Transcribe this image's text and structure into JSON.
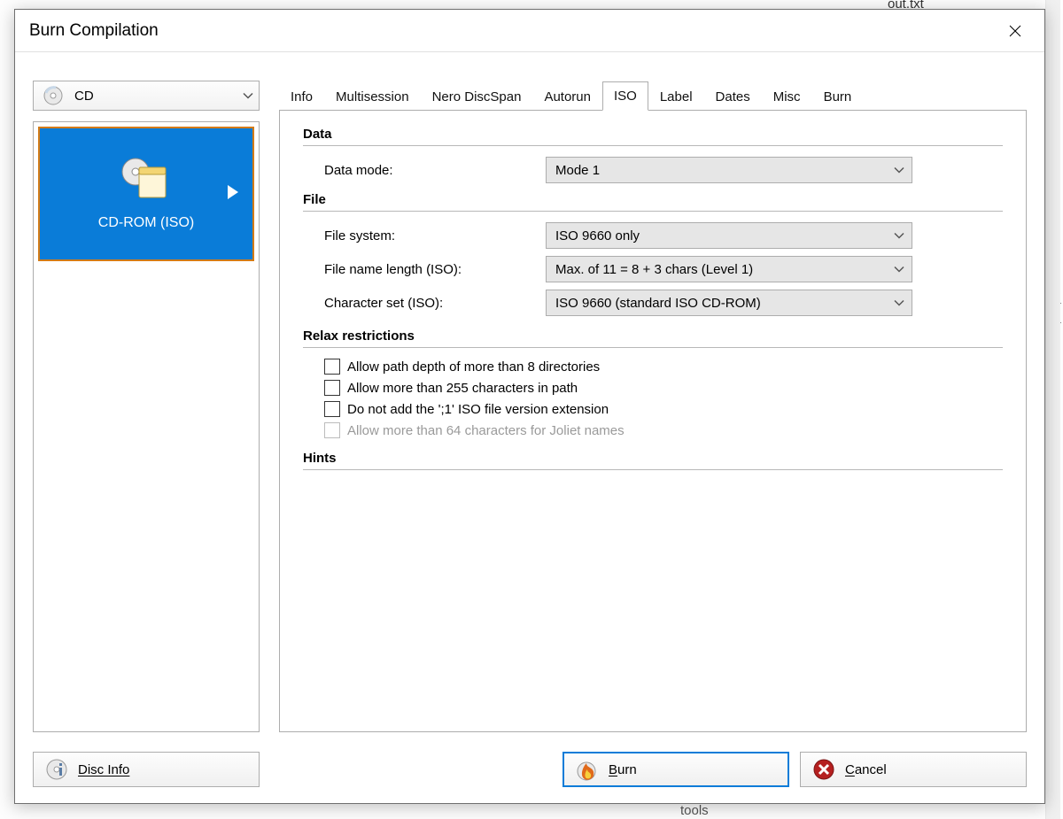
{
  "window": {
    "title": "Burn Compilation"
  },
  "background": {
    "file1": "out.txt",
    "trunc1": "t_",
    "trunc2": "t_",
    "folder": "tools"
  },
  "media_select": {
    "value": "CD"
  },
  "sidebar": {
    "tile_label": "CD-ROM (ISO)"
  },
  "tabs": [
    "Info",
    "Multisession",
    "Nero DiscSpan",
    "Autorun",
    "ISO",
    "Label",
    "Dates",
    "Misc",
    "Burn"
  ],
  "active_tab_index": 4,
  "sections": {
    "data": {
      "title": "Data",
      "fields": {
        "data_mode": {
          "label": "Data mode:",
          "value": "Mode 1"
        }
      }
    },
    "file": {
      "title": "File",
      "fields": {
        "file_system": {
          "label": "File system:",
          "value": "ISO 9660 only"
        },
        "filename_len": {
          "label": "File name length (ISO):",
          "value": "Max. of 11 = 8 + 3 chars (Level 1)"
        },
        "charset": {
          "label": "Character set (ISO):",
          "value": "ISO 9660 (standard ISO CD-ROM)"
        }
      }
    },
    "relax": {
      "title": "Relax restrictions",
      "checks": [
        {
          "label": "Allow path depth of more than 8 directories",
          "disabled": false
        },
        {
          "label": "Allow more than 255 characters in path",
          "disabled": false
        },
        {
          "label": "Do not add the ';1' ISO file version extension",
          "disabled": false
        },
        {
          "label": "Allow more than 64 characters for Joliet names",
          "disabled": true
        }
      ]
    },
    "hints": {
      "title": "Hints"
    }
  },
  "footer": {
    "disc_info": "Disc Info",
    "burn": "Burn",
    "cancel": "Cancel"
  }
}
